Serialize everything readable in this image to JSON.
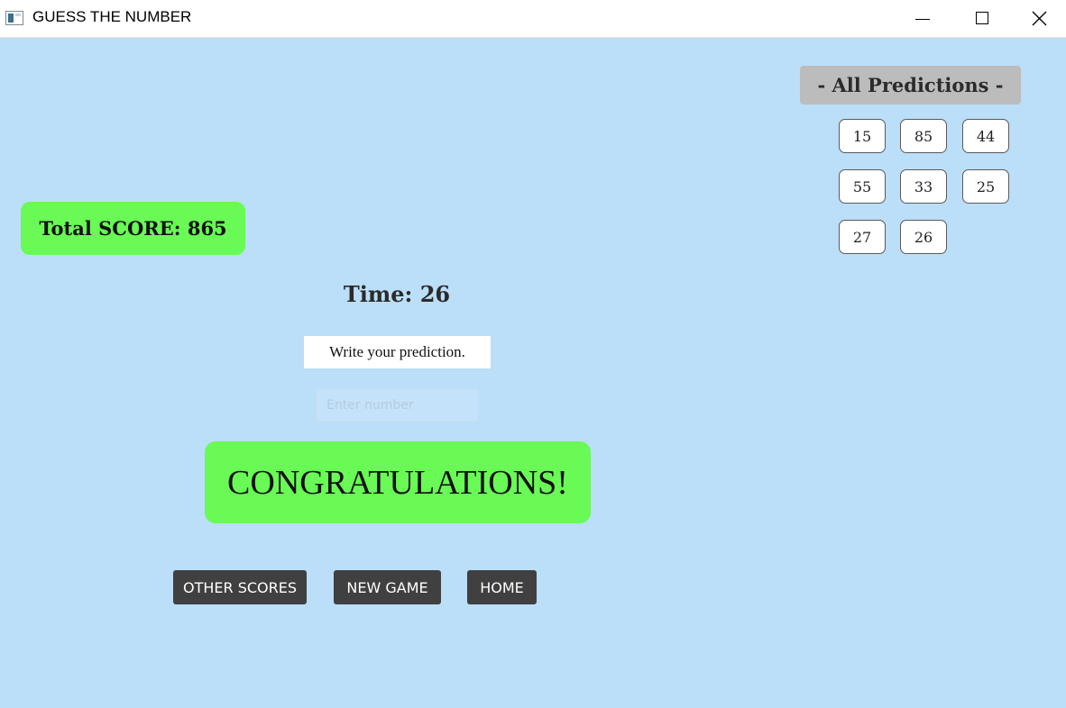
{
  "window": {
    "title": "GUESS THE NUMBER",
    "icons": [
      "app-icon",
      "minimize-icon",
      "maximize-icon",
      "close-icon"
    ]
  },
  "game": {
    "total_score": "Total SCORE: 865",
    "timer": "Time: 26",
    "instruction": "Write your prediction.",
    "input_placeholder": "Enter number",
    "input_value": "",
    "result_message": "CONGRATULATIONS!"
  },
  "buttons": {
    "other_scores": "OTHER SCORES",
    "new_game": "NEW GAME",
    "home": "HOME"
  },
  "predictions": {
    "header": "- All Predictions -",
    "values": [
      "15",
      "85",
      "44",
      "55",
      "33",
      "25",
      "27",
      "26"
    ]
  },
  "colors": {
    "background": "#bbdef9",
    "success_green": "#69fa55",
    "button_dark": "#404040",
    "header_gray": "#bcbcbc"
  }
}
